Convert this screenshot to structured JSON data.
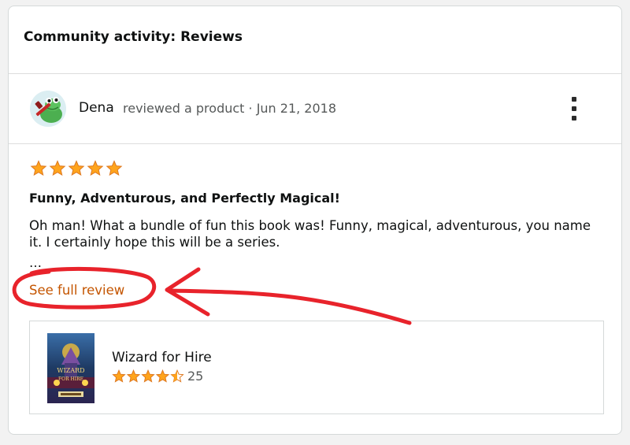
{
  "section": {
    "title": "Community activity: Reviews"
  },
  "author": {
    "name": "Dena",
    "meta": "reviewed a product · Jun 21, 2018",
    "avatar_icon": "frog-avatar-icon"
  },
  "menu": {
    "icon": "kebab-menu-icon"
  },
  "review": {
    "rating": 5,
    "rating_max": 5,
    "title": "Funny, Adventurous, and Perfectly Magical!",
    "body": "Oh man! What a bundle of fun this book was! Funny, magical, adventurous, you name it. I certainly hope this will be a series.",
    "ellipsis": "…",
    "see_full_label": "See full review"
  },
  "product": {
    "title": "Wizard for Hire",
    "rating": 4.5,
    "rating_max": 5,
    "rating_count": "25",
    "cover_text": "WIZARD FOR HIRE"
  },
  "colors": {
    "star": "#ffa41c",
    "star_outline": "#de7921",
    "link": "#c45500",
    "annotation_red": "#e8232b"
  }
}
